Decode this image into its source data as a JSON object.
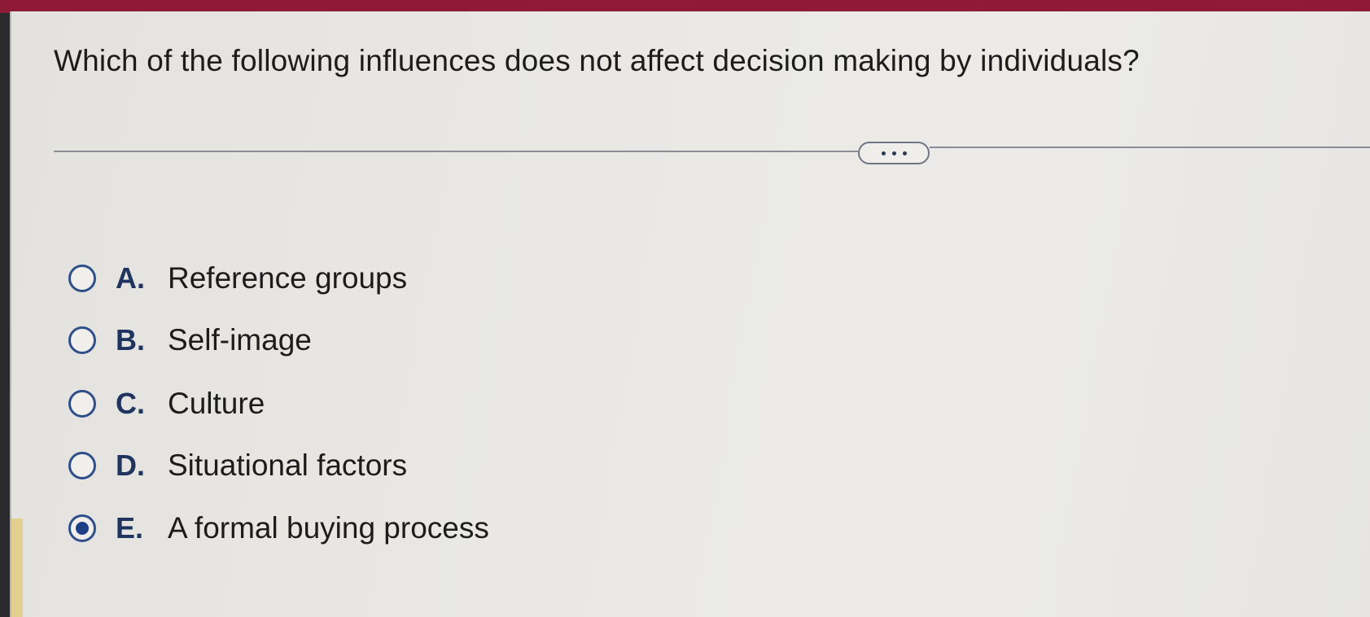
{
  "question": "Which of the following influences does not affect decision making by individuals?",
  "expand_button": {
    "icon": "ellipsis-icon"
  },
  "options": [
    {
      "letter": "A.",
      "text": "Reference groups",
      "selected": false
    },
    {
      "letter": "B.",
      "text": "Self-image",
      "selected": false
    },
    {
      "letter": "C.",
      "text": "Culture",
      "selected": false
    },
    {
      "letter": "D.",
      "text": "Situational factors",
      "selected": false
    },
    {
      "letter": "E.",
      "text": "A formal buying process",
      "selected": true
    }
  ],
  "colors": {
    "header_bar": "#8e1a38",
    "radio_accent": "#1e3f86",
    "letter": "#1f3560",
    "text": "#1c1c1c"
  }
}
